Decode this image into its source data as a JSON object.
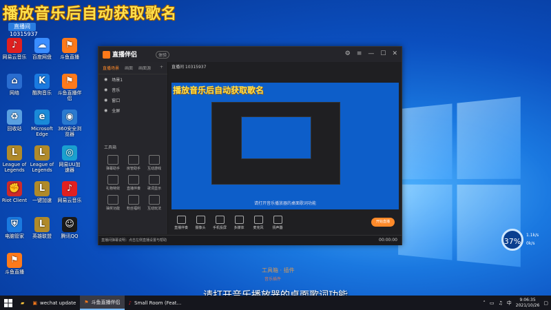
{
  "overlay": {
    "title": "播放音乐后自动获取歌名",
    "live_badge": "直播间",
    "live_id": "10315937"
  },
  "desktop_icons": [
    {
      "label": "网易云音乐",
      "glyph": "♪",
      "color": "#e02020"
    },
    {
      "label": "百度网盘",
      "glyph": "☁",
      "color": "#3a8dff"
    },
    {
      "label": "斗鱼直播",
      "glyph": "⚑",
      "color": "#ff7a1a"
    },
    {
      "label": "网络",
      "glyph": "⌂",
      "color": "#2a6dd0"
    },
    {
      "label": "酷狗音乐",
      "glyph": "K",
      "color": "#1a7ae0"
    },
    {
      "label": "斗鱼直播伴侣",
      "glyph": "⚑",
      "color": "#ff7a1a"
    },
    {
      "label": "回收站",
      "glyph": "♻",
      "color": "#5aa0e0"
    },
    {
      "label": "Microsoft Edge",
      "glyph": "e",
      "color": "#1a8ad8"
    },
    {
      "label": "360安全浏览器",
      "glyph": "◉",
      "color": "#2a7ad0"
    },
    {
      "label": "League of Legends",
      "glyph": "L",
      "color": "#b08a2a"
    },
    {
      "label": "League of Legends",
      "glyph": "L",
      "color": "#b08a2a"
    },
    {
      "label": "网易UU加速器",
      "glyph": "◎",
      "color": "#1aa0d0"
    },
    {
      "label": "Riot Client",
      "glyph": "✊",
      "color": "#d02a2a"
    },
    {
      "label": "一键加速",
      "glyph": "L",
      "color": "#b08a2a"
    },
    {
      "label": "网易云音乐",
      "glyph": "♪",
      "color": "#e02020"
    },
    {
      "label": "电脑管家",
      "glyph": "⛨",
      "color": "#1a7ae0"
    },
    {
      "label": "英雄联盟",
      "glyph": "L",
      "color": "#b08a2a"
    },
    {
      "label": "腾讯QQ",
      "glyph": "☺",
      "color": "#1a1a1a"
    },
    {
      "label": "斗鱼直播",
      "glyph": "⚑",
      "color": "#ff7a1a"
    }
  ],
  "app": {
    "logo": "直播伴侣",
    "version": "体验",
    "side_tabs": [
      "直播场景",
      "画面",
      "画面源"
    ],
    "scenes": [
      "场景1",
      "音乐",
      "窗口",
      "全屏"
    ],
    "tools_title": "工具箱",
    "tools": [
      "弹幕助手",
      "房管助手",
      "互动游戏",
      "礼物特效",
      "直播伴奏",
      "歌词显示",
      "抽奖功能",
      "粉丝福利",
      "互动玩法"
    ],
    "header": "直播间 10315937",
    "preview_title": "播放音乐后自动获取歌名",
    "preview_caption": "请打开音乐播放器的桌面歌词功能",
    "toolbar": [
      "直播伴奏",
      "摄像头",
      "手机投屏",
      "多媒体",
      "麦克风",
      "扬声器"
    ],
    "start_button": "开始直播",
    "status_note": "直播间弹幕说明：点击左侧直播设置与帮助",
    "status_time": "00:00:00"
  },
  "subtitle_small": "工具箱 · 插件",
  "subtitle_small2": "音乐插件",
  "subtitle": "请打开音乐播放器的桌面歌词功能",
  "perf": {
    "value": "37%",
    "up": "1.1k/s",
    "down": "0k/s"
  },
  "taskbar": {
    "items": [
      "wechat update",
      "斗鱼直播伴侣",
      "Small Room (Feat..."
    ],
    "ime": "中",
    "time": "9:06:35",
    "date": "2021/10/26"
  }
}
